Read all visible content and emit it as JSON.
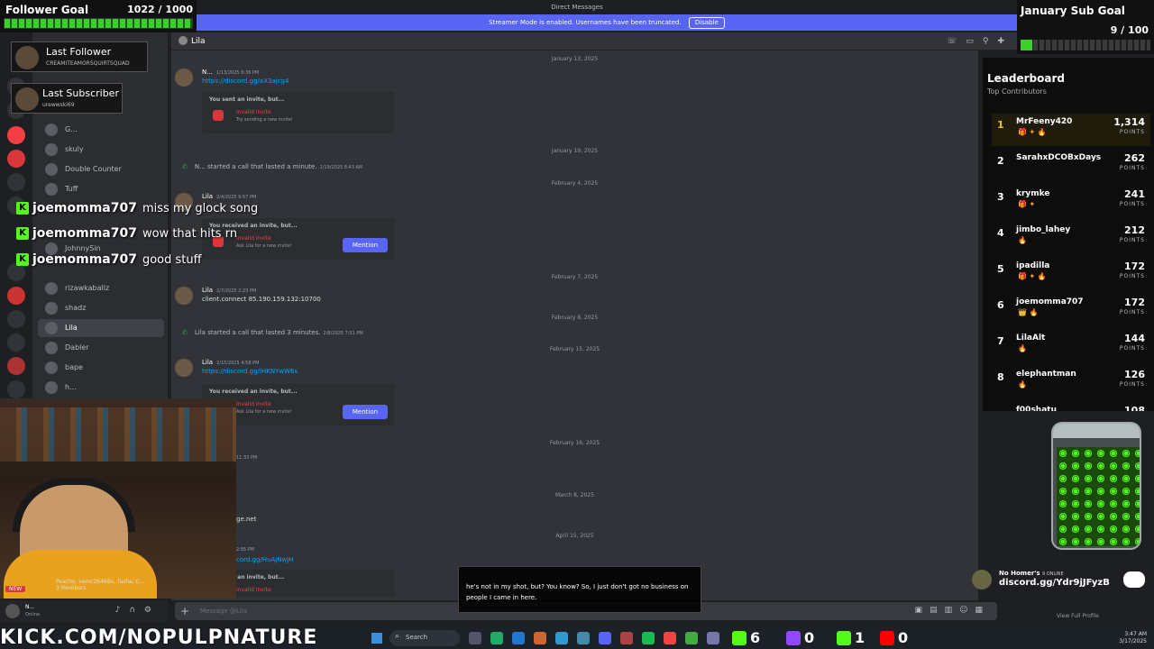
{
  "window": {
    "title": "Direct Messages",
    "streamer_mode_text": "Streamer Mode is enabled. Usernames have been truncated.",
    "disable_label": "Disable"
  },
  "follower_goal": {
    "label": "Follower Goal",
    "count": "1022 / 1000",
    "progress": 1.0
  },
  "last_follower": {
    "label": "Last Follower",
    "name": "CREAMITEAMORSQUIRTSQUAD"
  },
  "last_subscriber": {
    "label": "Last Subscriber",
    "name": "urewwski69"
  },
  "sub_goal": {
    "label": "January Sub Goal",
    "count": "9 / 100",
    "progress": 0.09
  },
  "dm_list": {
    "items": [
      {
        "name": "G...",
        "active": false
      },
      {
        "name": "skuly",
        "active": false
      },
      {
        "name": "Double Counter",
        "active": false
      },
      {
        "name": "Tuff",
        "active": false
      },
      {
        "name": "JohnnySin",
        "active": false
      },
      {
        "name": "rizawkaballz",
        "active": false
      },
      {
        "name": "shadz",
        "active": false
      },
      {
        "name": "Lila",
        "active": true
      },
      {
        "name": "Dabler",
        "active": false
      },
      {
        "name": "bape",
        "active": false
      },
      {
        "name": "h...",
        "active": false
      }
    ]
  },
  "chat_overlay": [
    {
      "user": "joemomma707",
      "message": "miss my glock song"
    },
    {
      "user": "joemomma707",
      "message": "wow that hits rn"
    },
    {
      "user": "joemomma707",
      "message": "good stuff"
    }
  ],
  "chat": {
    "channel_name": "Lila",
    "dates": [
      "January 13, 2025",
      "January 19, 2025",
      "February 4, 2025",
      "February 7, 2025",
      "February 8, 2025",
      "February 15, 2025",
      "February 16, 2025",
      "March 8, 2025",
      "April 15, 2025"
    ],
    "messages": [
      {
        "author": "N...",
        "time": "1/13/2025 8:36 PM",
        "link": "https://discord.gg/aX3ajcg4"
      },
      {
        "author": "Lila",
        "time": "2/4/2025 9:57 PM"
      },
      {
        "author": "Lila",
        "time": "2/7/2025 2:23 PM",
        "text": "client.connect 85.190.159.132:10700"
      },
      {
        "author": "Lila",
        "time": "2/15/2025 4:58 PM",
        "link": "https://discord.gg/IHKNYwW6s"
      }
    ],
    "calls": [
      {
        "author": "N...",
        "text": "started a call that lasted a minute.",
        "time": "1/19/2025 8:43 AM"
      },
      {
        "author": "Lila",
        "text": "started a call that lasted 3 minutes.",
        "time": "2/8/2025 7:51 PM"
      }
    ],
    "invites": [
      {
        "head": "You sent an invite, but...",
        "title": "Invalid Invite",
        "sub": "Try sending a new invite!"
      },
      {
        "head": "You received an invite, but...",
        "title": "Invalid Invite",
        "sub": "Ask Lila for a new invite!"
      },
      {
        "head": "You received an invite, but...",
        "title": "Invalid Invite",
        "sub": "Ask Lila for a new invite!"
      },
      {
        "head": "You sent an invite, but...",
        "title": "Invalid Invite"
      }
    ],
    "mention_label": "Mention",
    "fragments": [
      "11:33 PM",
      "ge.net",
      "2:05 PM",
      "cord.gg/HuAjNwJH"
    ],
    "composer_placeholder": "Message @Lila"
  },
  "user_panel": {
    "name": "N...",
    "status": "Online"
  },
  "webcam": {
    "new_badge": "NEW",
    "group_info": "Peachy, xemc26468x, Tasha, C...",
    "members": "3 Members"
  },
  "leaderboard": {
    "title": "Leaderboard",
    "subtitle": "Top Contributors",
    "points_label": "POINTS",
    "rows": [
      {
        "rank": "1",
        "name": "MrFeeny420",
        "points": "1,314",
        "badges": "🎁 ✦ 🔥"
      },
      {
        "rank": "2",
        "name": "SarahxDCOBxDays",
        "points": "262",
        "badges": ""
      },
      {
        "rank": "3",
        "name": "krymke",
        "points": "241",
        "badges": "🎁 ✦"
      },
      {
        "rank": "4",
        "name": "jimbo_lahey",
        "points": "212",
        "badges": "🔥"
      },
      {
        "rank": "5",
        "name": "ipadilla",
        "points": "172",
        "badges": "🎁 ✦ 🔥"
      },
      {
        "rank": "6",
        "name": "joemomma707",
        "points": "172",
        "badges": "👑 🔥"
      },
      {
        "rank": "7",
        "name": "LilaAlt",
        "points": "144",
        "badges": "🔥"
      },
      {
        "rank": "8",
        "name": "elephantman",
        "points": "126",
        "badges": "🔥"
      },
      {
        "rank": "",
        "name": "f00shatu",
        "points": "108",
        "badges": ""
      }
    ]
  },
  "caption": {
    "text": "he's not in my shot, but? You know? So, I just don't got no business on people I came in here."
  },
  "promo": {
    "title": "No Homer's",
    "online": "9 ONLINE",
    "invite": "discord.gg/Ydr9jJFyzB",
    "view_profile": "View Full Profile"
  },
  "taskbar": {
    "kick_url": "KICK.COM/NOPULPNATURE",
    "search_label": "Search",
    "stats": [
      {
        "value": "6",
        "color": "#53fc18"
      },
      {
        "value": "0",
        "color": "#9146ff"
      },
      {
        "value": "1",
        "color": "#53fc18"
      },
      {
        "value": "0",
        "color": "#ff0000"
      }
    ],
    "time": "3:47 AM",
    "date": "3/17/2025"
  },
  "colors": {
    "accent": "#5865f2",
    "kick_green": "#53fc18",
    "invalid_red": "#f23f43",
    "link_blue": "#00a8fc"
  },
  "icons": {
    "header": [
      "phone-icon",
      "video-icon",
      "pin-icon",
      "add-member-icon"
    ],
    "composer": [
      "gift-icon",
      "gif-icon",
      "sticker-icon",
      "emoji-icon",
      "apps-icon"
    ],
    "user_controls": [
      "mic-icon",
      "headphones-icon",
      "settings-icon"
    ]
  }
}
